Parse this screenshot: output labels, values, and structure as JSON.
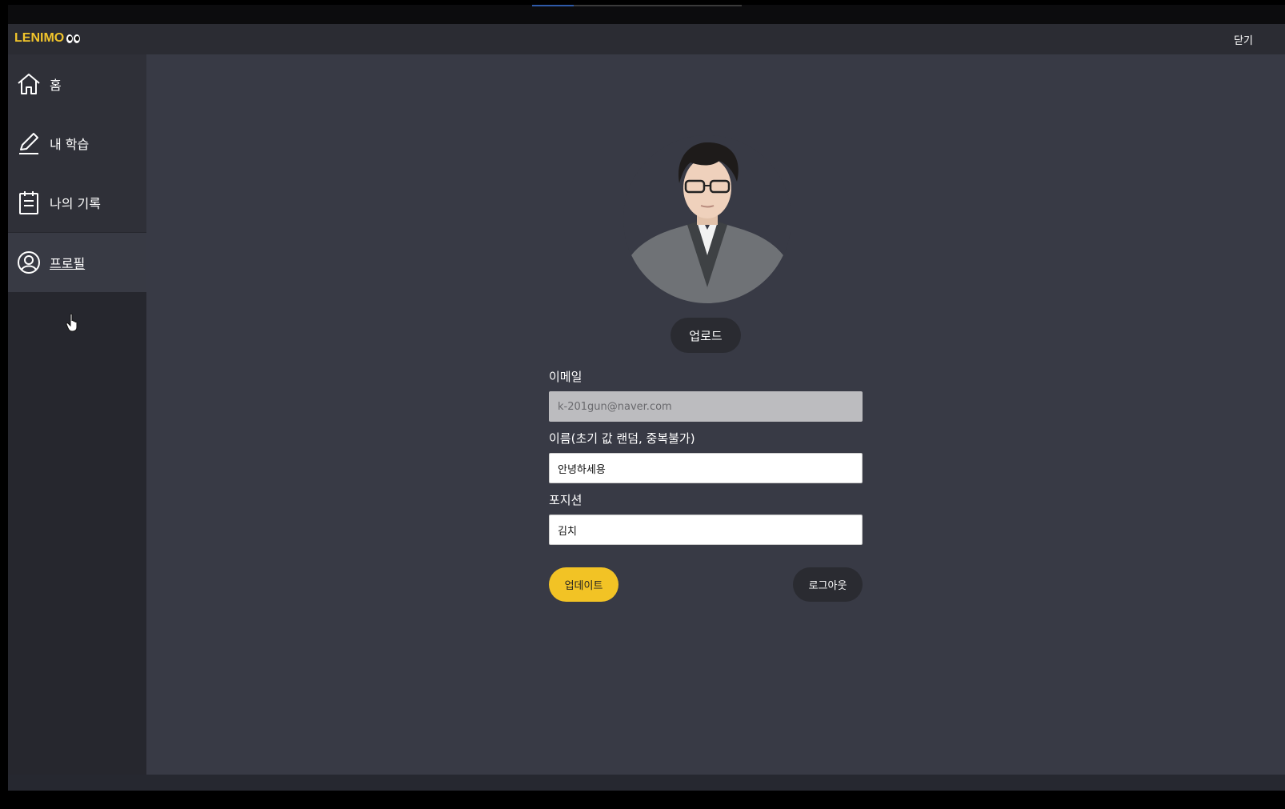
{
  "header": {
    "logo_text": "LENIMO",
    "close_label": "닫기"
  },
  "sidebar": {
    "items": [
      {
        "label": "홈",
        "icon": "home-icon"
      },
      {
        "label": "내 학습",
        "icon": "pencil-icon"
      },
      {
        "label": "나의 기록",
        "icon": "clipboard-icon"
      },
      {
        "label": "프로필",
        "icon": "user-circle-icon",
        "active": true
      }
    ]
  },
  "profile": {
    "upload_label": "업로드",
    "email": {
      "label": "이메일",
      "value": "k-201gun@naver.com"
    },
    "name": {
      "label": "이름(초기 값 랜덤, 중복불가)",
      "value": "안녕하세용"
    },
    "position": {
      "label": "포지션",
      "value": "김치"
    },
    "update_label": "업데이트",
    "logout_label": "로그아웃"
  },
  "colors": {
    "accent": "#f2c325",
    "background": "#383a45",
    "sidebar": "#2f3038"
  }
}
